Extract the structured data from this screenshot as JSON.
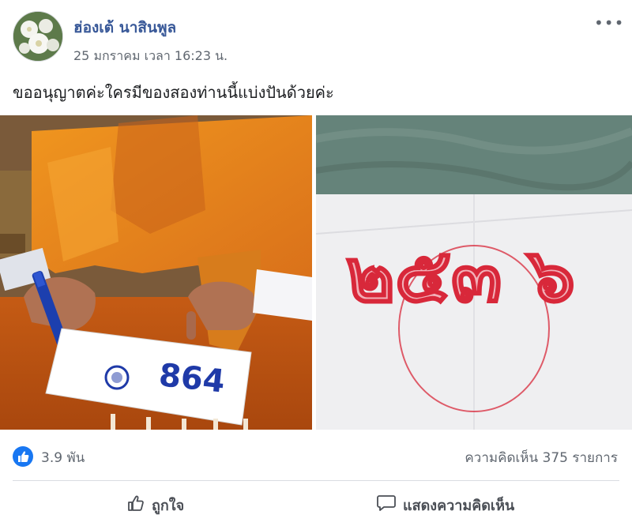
{
  "post": {
    "author": "ฮ่องเต้ นาสินพูล",
    "timestamp": "25 มกราคม เวลา 16:23 น.",
    "more_icon": "more-horizontal-icon",
    "text": "ขออนุญาตค่ะใครมีของสองท่านนี้แบ่งปันด้วยค่ะ"
  },
  "photos": {
    "left_card_number": "864",
    "right_paper_digits": "๒๕๓ ๖"
  },
  "reactions": {
    "like_count": "3.9 พัน",
    "comment_count": "ความคิดเห็น 375 รายการ"
  },
  "actions": {
    "like_label": "ถูกใจ",
    "comment_label": "แสดงความคิดเห็น"
  },
  "colors": {
    "link": "#385898",
    "accent": "#1877f2",
    "robe": "#e8861c",
    "ink_red": "#d8283a"
  }
}
